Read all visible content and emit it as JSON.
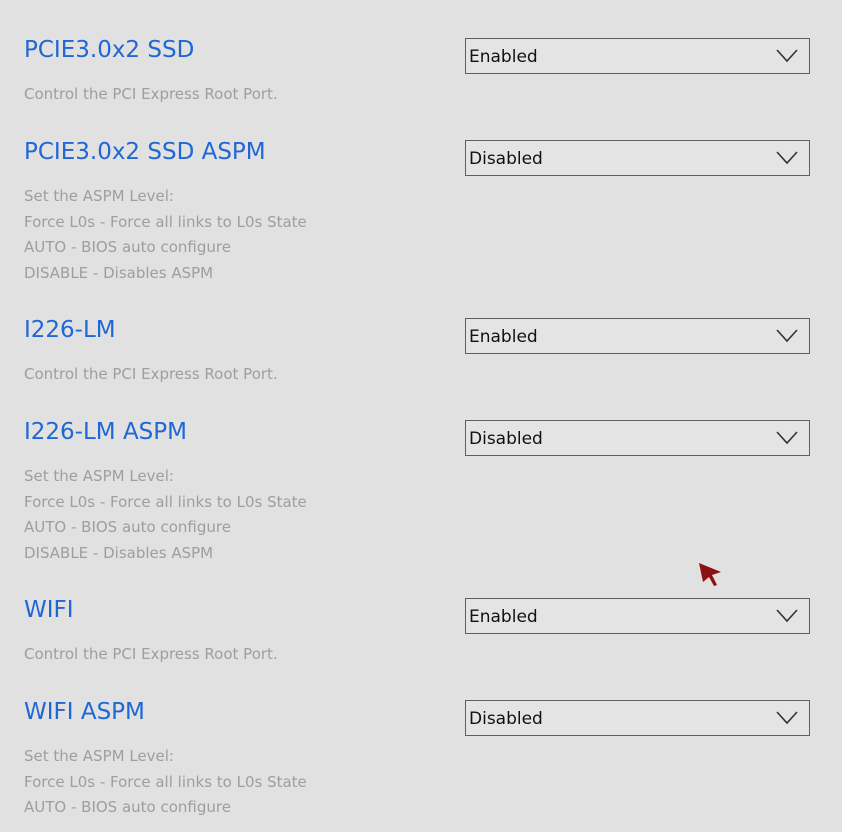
{
  "settings": [
    {
      "title": "PCIE3.0x2 SSD",
      "description": [
        "Control the PCI Express Root Port."
      ],
      "value": "Enabled"
    },
    {
      "title": "PCIE3.0x2 SSD ASPM",
      "description": [
        "Set the ASPM Level:",
        "Force L0s - Force all links to L0s State",
        "AUTO - BIOS auto configure",
        "DISABLE - Disables ASPM"
      ],
      "value": "Disabled"
    },
    {
      "title": "I226-LM",
      "description": [
        "Control the PCI Express Root Port."
      ],
      "value": "Enabled"
    },
    {
      "title": "I226-LM ASPM",
      "description": [
        "Set the ASPM Level:",
        "Force L0s - Force all links to L0s State",
        "AUTO - BIOS auto configure",
        "DISABLE - Disables ASPM"
      ],
      "value": "Disabled"
    },
    {
      "title": "WIFI",
      "description": [
        "Control the PCI Express Root Port."
      ],
      "value": "Enabled"
    },
    {
      "title": "WIFI ASPM",
      "description": [
        "Set the ASPM Level:",
        "Force L0s - Force all links to L0s State",
        "AUTO - BIOS auto configure"
      ],
      "value": "Disabled"
    }
  ],
  "icons": {
    "dropdown": "chevron-down-icon",
    "pointer": "mouse-pointer-icon"
  },
  "colors": {
    "title": "#1f66d6",
    "description": "#9c9ea3",
    "background": "#e1e1e1",
    "cursor": "#8b1212"
  }
}
